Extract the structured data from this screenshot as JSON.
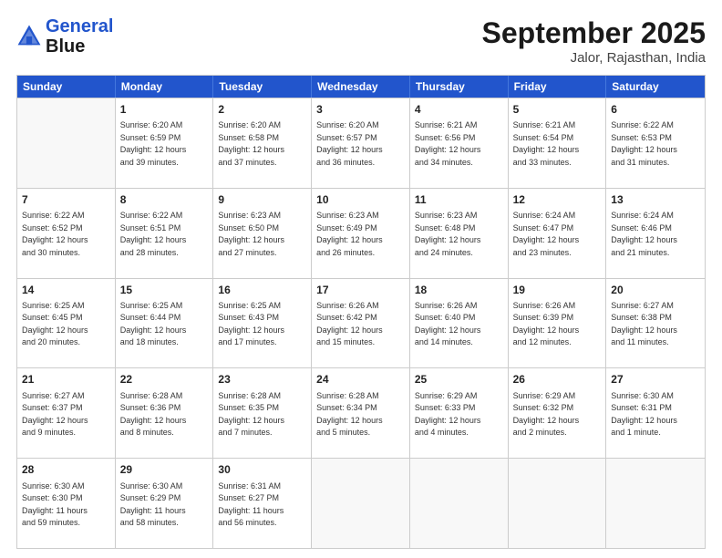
{
  "header": {
    "logo_line1": "General",
    "logo_line2": "Blue",
    "month_title": "September 2025",
    "location": "Jalor, Rajasthan, India"
  },
  "weekdays": [
    "Sunday",
    "Monday",
    "Tuesday",
    "Wednesday",
    "Thursday",
    "Friday",
    "Saturday"
  ],
  "weeks": [
    [
      {
        "day": "",
        "info": ""
      },
      {
        "day": "1",
        "info": "Sunrise: 6:20 AM\nSunset: 6:59 PM\nDaylight: 12 hours\nand 39 minutes."
      },
      {
        "day": "2",
        "info": "Sunrise: 6:20 AM\nSunset: 6:58 PM\nDaylight: 12 hours\nand 37 minutes."
      },
      {
        "day": "3",
        "info": "Sunrise: 6:20 AM\nSunset: 6:57 PM\nDaylight: 12 hours\nand 36 minutes."
      },
      {
        "day": "4",
        "info": "Sunrise: 6:21 AM\nSunset: 6:56 PM\nDaylight: 12 hours\nand 34 minutes."
      },
      {
        "day": "5",
        "info": "Sunrise: 6:21 AM\nSunset: 6:54 PM\nDaylight: 12 hours\nand 33 minutes."
      },
      {
        "day": "6",
        "info": "Sunrise: 6:22 AM\nSunset: 6:53 PM\nDaylight: 12 hours\nand 31 minutes."
      }
    ],
    [
      {
        "day": "7",
        "info": "Sunrise: 6:22 AM\nSunset: 6:52 PM\nDaylight: 12 hours\nand 30 minutes."
      },
      {
        "day": "8",
        "info": "Sunrise: 6:22 AM\nSunset: 6:51 PM\nDaylight: 12 hours\nand 28 minutes."
      },
      {
        "day": "9",
        "info": "Sunrise: 6:23 AM\nSunset: 6:50 PM\nDaylight: 12 hours\nand 27 minutes."
      },
      {
        "day": "10",
        "info": "Sunrise: 6:23 AM\nSunset: 6:49 PM\nDaylight: 12 hours\nand 26 minutes."
      },
      {
        "day": "11",
        "info": "Sunrise: 6:23 AM\nSunset: 6:48 PM\nDaylight: 12 hours\nand 24 minutes."
      },
      {
        "day": "12",
        "info": "Sunrise: 6:24 AM\nSunset: 6:47 PM\nDaylight: 12 hours\nand 23 minutes."
      },
      {
        "day": "13",
        "info": "Sunrise: 6:24 AM\nSunset: 6:46 PM\nDaylight: 12 hours\nand 21 minutes."
      }
    ],
    [
      {
        "day": "14",
        "info": "Sunrise: 6:25 AM\nSunset: 6:45 PM\nDaylight: 12 hours\nand 20 minutes."
      },
      {
        "day": "15",
        "info": "Sunrise: 6:25 AM\nSunset: 6:44 PM\nDaylight: 12 hours\nand 18 minutes."
      },
      {
        "day": "16",
        "info": "Sunrise: 6:25 AM\nSunset: 6:43 PM\nDaylight: 12 hours\nand 17 minutes."
      },
      {
        "day": "17",
        "info": "Sunrise: 6:26 AM\nSunset: 6:42 PM\nDaylight: 12 hours\nand 15 minutes."
      },
      {
        "day": "18",
        "info": "Sunrise: 6:26 AM\nSunset: 6:40 PM\nDaylight: 12 hours\nand 14 minutes."
      },
      {
        "day": "19",
        "info": "Sunrise: 6:26 AM\nSunset: 6:39 PM\nDaylight: 12 hours\nand 12 minutes."
      },
      {
        "day": "20",
        "info": "Sunrise: 6:27 AM\nSunset: 6:38 PM\nDaylight: 12 hours\nand 11 minutes."
      }
    ],
    [
      {
        "day": "21",
        "info": "Sunrise: 6:27 AM\nSunset: 6:37 PM\nDaylight: 12 hours\nand 9 minutes."
      },
      {
        "day": "22",
        "info": "Sunrise: 6:28 AM\nSunset: 6:36 PM\nDaylight: 12 hours\nand 8 minutes."
      },
      {
        "day": "23",
        "info": "Sunrise: 6:28 AM\nSunset: 6:35 PM\nDaylight: 12 hours\nand 7 minutes."
      },
      {
        "day": "24",
        "info": "Sunrise: 6:28 AM\nSunset: 6:34 PM\nDaylight: 12 hours\nand 5 minutes."
      },
      {
        "day": "25",
        "info": "Sunrise: 6:29 AM\nSunset: 6:33 PM\nDaylight: 12 hours\nand 4 minutes."
      },
      {
        "day": "26",
        "info": "Sunrise: 6:29 AM\nSunset: 6:32 PM\nDaylight: 12 hours\nand 2 minutes."
      },
      {
        "day": "27",
        "info": "Sunrise: 6:30 AM\nSunset: 6:31 PM\nDaylight: 12 hours\nand 1 minute."
      }
    ],
    [
      {
        "day": "28",
        "info": "Sunrise: 6:30 AM\nSunset: 6:30 PM\nDaylight: 11 hours\nand 59 minutes."
      },
      {
        "day": "29",
        "info": "Sunrise: 6:30 AM\nSunset: 6:29 PM\nDaylight: 11 hours\nand 58 minutes."
      },
      {
        "day": "30",
        "info": "Sunrise: 6:31 AM\nSunset: 6:27 PM\nDaylight: 11 hours\nand 56 minutes."
      },
      {
        "day": "",
        "info": ""
      },
      {
        "day": "",
        "info": ""
      },
      {
        "day": "",
        "info": ""
      },
      {
        "day": "",
        "info": ""
      }
    ]
  ]
}
